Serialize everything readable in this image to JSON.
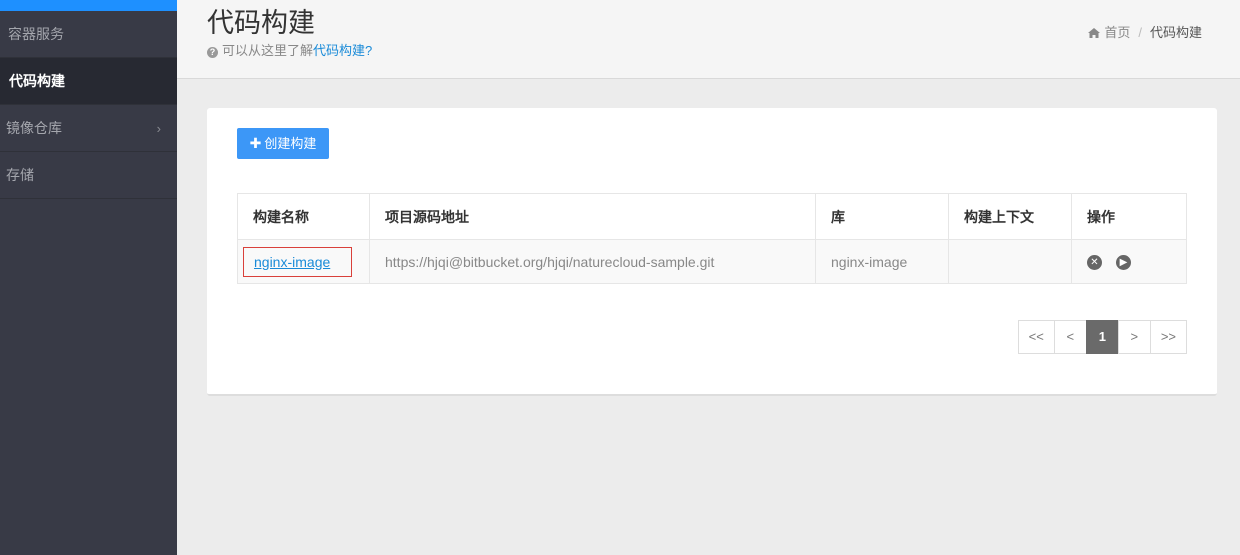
{
  "sidebar": {
    "items": [
      {
        "label": "容器服务"
      },
      {
        "label": "代码构建"
      },
      {
        "label": "镜像仓库",
        "chevron": "›"
      },
      {
        "label": "存储"
      }
    ]
  },
  "header": {
    "title": "代码构建",
    "subtitle_prefix": "可以从这里了解",
    "subtitle_link": "代码构建?",
    "breadcrumb_home": "首页",
    "breadcrumb_sep": "/",
    "breadcrumb_current": "代码构建"
  },
  "toolbar": {
    "create_label": "创建构建"
  },
  "table": {
    "columns": [
      "构建名称",
      "项目源码地址",
      "库",
      "构建上下文",
      "操作"
    ],
    "rows": [
      {
        "name": "nginx-image",
        "repo_url": "https://hjqi@bitbucket.org/hjqi/naturecloud-sample.git",
        "library": "nginx-image",
        "context": ""
      }
    ]
  },
  "pagination": {
    "first": "<<",
    "prev": "<",
    "current": "1",
    "next": ">",
    "last": ">>"
  },
  "colors": {
    "accent": "#3c97f7",
    "sidebar_bg": "#383a46",
    "link": "#1a8bd8"
  }
}
